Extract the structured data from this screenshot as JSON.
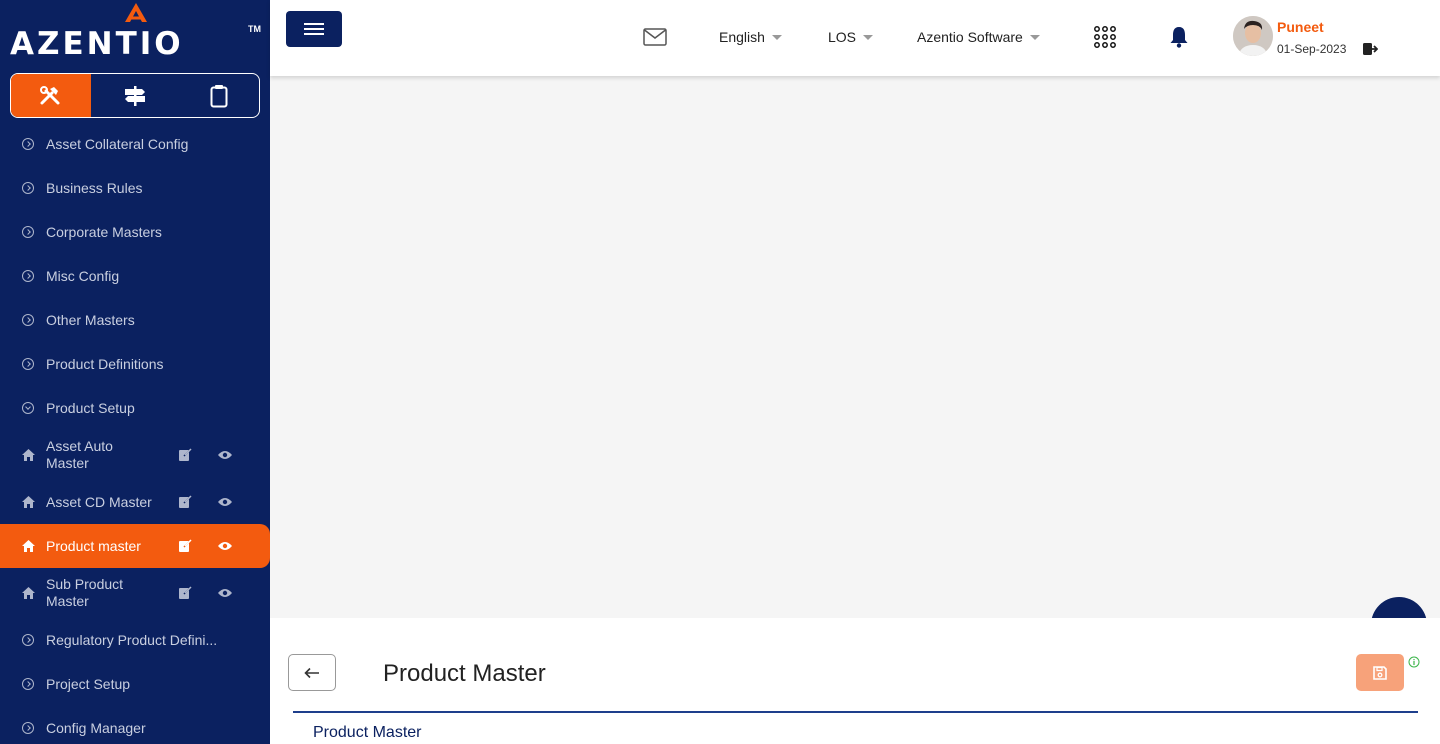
{
  "brand": {
    "name": "AZENTIO",
    "tm": "TM"
  },
  "sidebar": {
    "tool_tabs": [
      {
        "icon": "tools-icon",
        "active": true
      },
      {
        "icon": "signpost-icon",
        "active": false
      },
      {
        "icon": "clipboard-icon",
        "active": false
      }
    ],
    "items": [
      {
        "label": "Asset Collateral Config",
        "type": "group"
      },
      {
        "label": "Business Rules",
        "type": "group"
      },
      {
        "label": "Corporate Masters",
        "type": "group"
      },
      {
        "label": "Misc Config",
        "type": "group"
      },
      {
        "label": "Other Masters",
        "type": "group"
      },
      {
        "label": "Product Definitions",
        "type": "group"
      },
      {
        "label": "Product Setup",
        "type": "group-open"
      },
      {
        "label": "Asset Auto Master",
        "type": "page"
      },
      {
        "label": "Asset CD Master",
        "type": "page"
      },
      {
        "label": "Product master",
        "type": "page",
        "active": true
      },
      {
        "label": "Sub Product Master",
        "type": "page"
      },
      {
        "label": "Regulatory Product Defini...",
        "type": "group"
      },
      {
        "label": "Project Setup",
        "type": "group"
      },
      {
        "label": "Config Manager",
        "type": "group"
      }
    ]
  },
  "topbar": {
    "language": "English",
    "module": "LOS",
    "company": "Azentio Software",
    "user": {
      "name": "Puneet",
      "date": "01-Sep-2023"
    }
  },
  "main": {
    "page_title": "Product Master",
    "section_title": "Product Master"
  },
  "colors": {
    "navy": "#0b2160",
    "accent": "#f35b0f",
    "save": "#f7a27a"
  }
}
